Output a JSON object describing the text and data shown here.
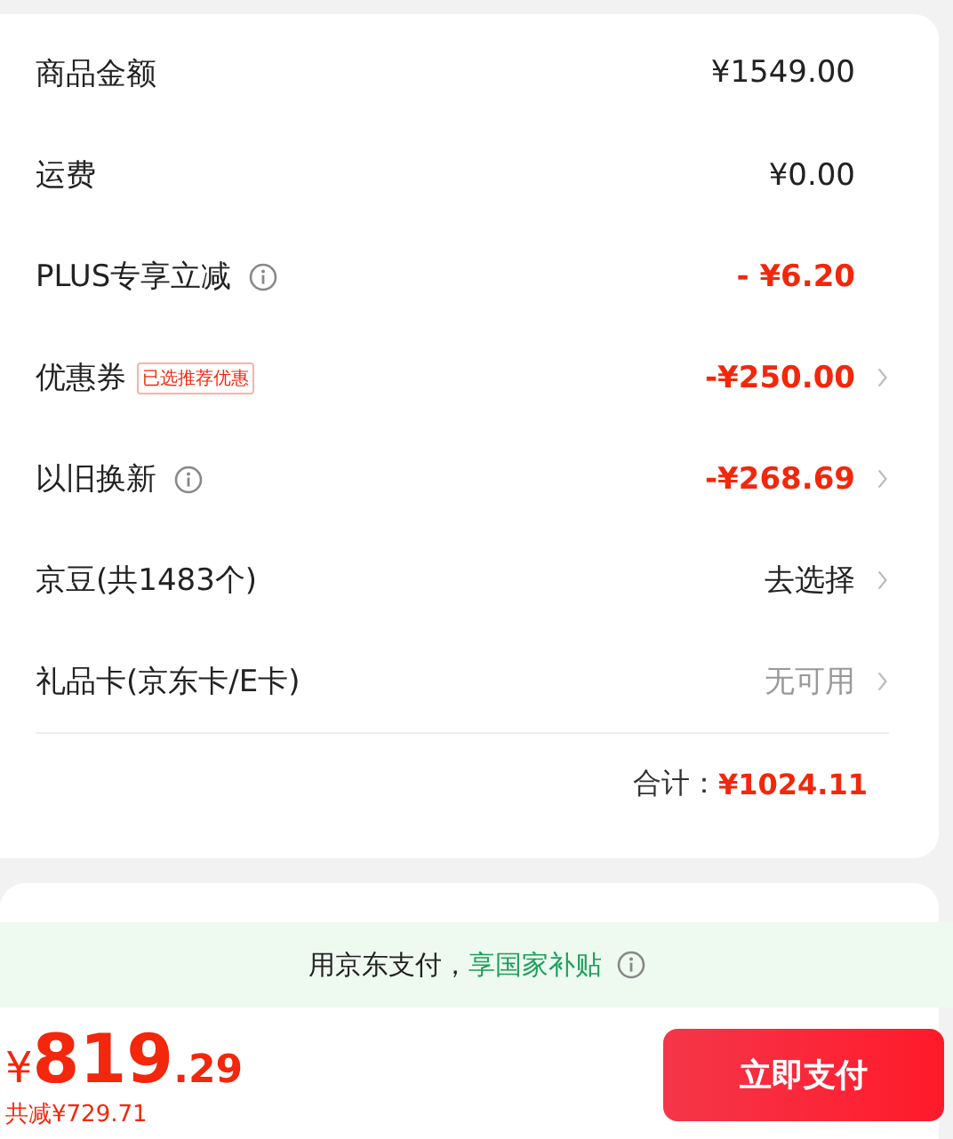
{
  "summary": {
    "rows": [
      {
        "label": "商品金额",
        "info": false,
        "value": "¥1549.00",
        "color": "#222222",
        "arrow": false
      },
      {
        "label": "运费",
        "info": false,
        "value": "¥0.00",
        "color": "#222222",
        "arrow": false
      },
      {
        "label": "PLUS专享立减",
        "info": true,
        "value": "- ¥6.20",
        "color": "#f2270c",
        "arrow": false
      },
      {
        "label": "优惠券",
        "tag": "已选推荐优惠",
        "info": false,
        "value": "-¥250.00",
        "color": "#f2270c",
        "arrow": true
      },
      {
        "label": "以旧换新",
        "info": true,
        "value": "-¥268.69",
        "color": "#f2270c",
        "arrow": true
      },
      {
        "label": "京豆(共1483个)",
        "info": false,
        "value": "去选择",
        "color": "#222222",
        "arrow": true
      },
      {
        "label": "礼品卡(京东卡/E卡)",
        "info": false,
        "value": "无可用",
        "color": "#999999",
        "arrow": true
      }
    ],
    "total_label": "合计：",
    "total_value": "¥1024.11"
  },
  "banner": {
    "text": "用京东支付，",
    "highlight": "享国家补贴",
    "info": true
  },
  "footer": {
    "currency": "¥",
    "price_int": "819",
    "price_dec": ".29",
    "saved": "共减¥729.71",
    "pay_button": "立即支付"
  }
}
